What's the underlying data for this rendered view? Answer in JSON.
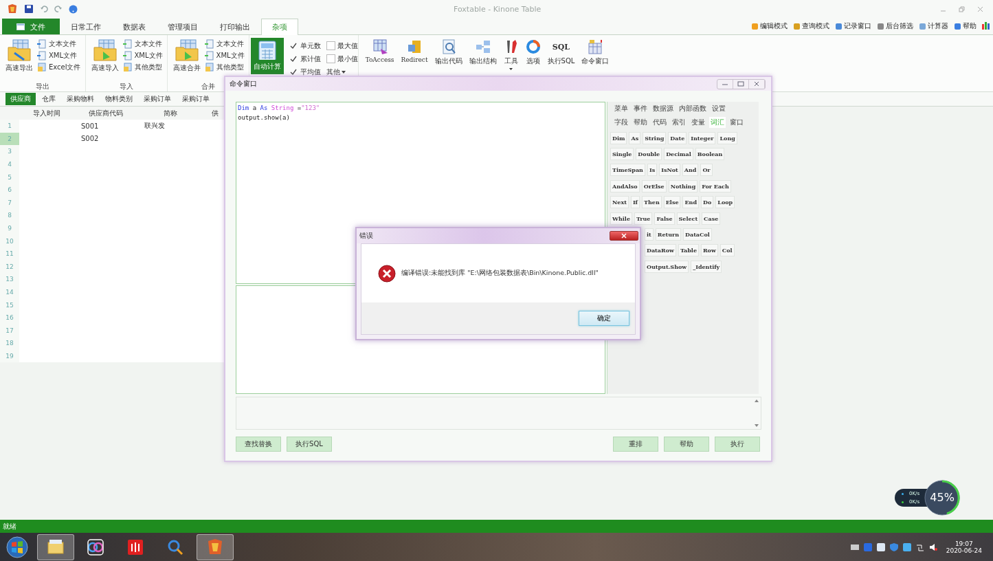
{
  "window": {
    "title": "Foxtable - Kinone Table"
  },
  "menu_tabs": [
    {
      "label": "文件",
      "kind": "file",
      "selected": false
    },
    {
      "label": "日常工作",
      "kind": "tab",
      "selected": false
    },
    {
      "label": "数据表",
      "kind": "tab",
      "selected": false
    },
    {
      "label": "管理项目",
      "kind": "tab",
      "selected": false
    },
    {
      "label": "打印输出",
      "kind": "tab",
      "selected": false
    },
    {
      "label": "杂项",
      "kind": "tab",
      "selected": true
    }
  ],
  "right_tools": [
    "编辑模式",
    "查询模式",
    "记录窗口",
    "后台筛选",
    "计算器",
    "帮助"
  ],
  "ribbon_groups": [
    {
      "label": "导出",
      "large": "高速导出",
      "small": [
        "文本文件",
        "XML文件",
        "Excel文件"
      ]
    },
    {
      "label": "导入",
      "large": "高速导入",
      "small": [
        "文本文件",
        "XML文件",
        "其他类型"
      ]
    },
    {
      "label": "合并",
      "large": "高速合并",
      "small": [
        "文本文件",
        "XML文件",
        "其他类型"
      ]
    }
  ],
  "auto_calc": {
    "label": "自动计算",
    "on": true
  },
  "calc_checks": [
    {
      "label": "单元数",
      "checked": true
    },
    {
      "label": "累计值",
      "checked": true
    },
    {
      "label": "平均值",
      "checked": true
    },
    {
      "label": "最大值",
      "checked": false
    },
    {
      "label": "最小值",
      "checked": false
    }
  ],
  "calc_more": "其他",
  "sql_icon_text": "SQL",
  "tool_buttons": [
    "ToAccess",
    "Redirect",
    "输出代码",
    "输出结构",
    "工具",
    "选项",
    "执行SQL",
    "命令窗口"
  ],
  "sheet_tabs": [
    {
      "label": "供应商",
      "selected": true
    },
    {
      "label": "仓库",
      "selected": false
    },
    {
      "label": "采购物料",
      "selected": false
    },
    {
      "label": "物料类别",
      "selected": false
    },
    {
      "label": "采购订单",
      "selected": false
    },
    {
      "label": "采购订单",
      "selected": false
    }
  ],
  "table": {
    "columns": [
      "导入时间",
      "供应商代码",
      "简称",
      "供"
    ],
    "rows": [
      {
        "number": "1",
        "selected": false,
        "cells": [
          "",
          "S001",
          "联兴发"
        ]
      },
      {
        "number": "2",
        "selected": true,
        "cells": [
          "",
          "S002",
          ""
        ]
      },
      {
        "number": "3",
        "selected": false,
        "cells": []
      },
      {
        "number": "4",
        "selected": false,
        "cells": []
      },
      {
        "number": "5",
        "selected": false,
        "cells": []
      },
      {
        "number": "6",
        "selected": false,
        "cells": []
      },
      {
        "number": "7",
        "selected": false,
        "cells": []
      },
      {
        "number": "8",
        "selected": false,
        "cells": []
      },
      {
        "number": "9",
        "selected": false,
        "cells": []
      },
      {
        "number": "10",
        "selected": false,
        "cells": []
      },
      {
        "number": "11",
        "selected": false,
        "cells": []
      },
      {
        "number": "12",
        "selected": false,
        "cells": []
      },
      {
        "number": "13",
        "selected": false,
        "cells": []
      },
      {
        "number": "14",
        "selected": false,
        "cells": []
      },
      {
        "number": "15",
        "selected": false,
        "cells": []
      },
      {
        "number": "16",
        "selected": false,
        "cells": []
      },
      {
        "number": "17",
        "selected": false,
        "cells": []
      },
      {
        "number": "18",
        "selected": false,
        "cells": []
      },
      {
        "number": "19",
        "selected": false,
        "cells": []
      }
    ]
  },
  "command_window": {
    "title": "命令窗口",
    "code_lines": [
      [
        {
          "text": "Dim",
          "kind": "keyword"
        },
        {
          "text": " a ",
          "kind": "plain"
        },
        {
          "text": "As ",
          "kind": "keyword"
        },
        {
          "text": "String",
          "kind": "type"
        },
        {
          "text": " =",
          "kind": "plain"
        },
        {
          "text": "\"123\"",
          "kind": "string"
        }
      ],
      [
        {
          "text": "output.show(a)",
          "kind": "plain"
        }
      ]
    ],
    "panel_tabs": [
      [
        {
          "label": "菜单",
          "selected": false
        },
        {
          "label": "事件",
          "selected": false
        },
        {
          "label": "数据源",
          "selected": false
        },
        {
          "label": "内部函数",
          "selected": false
        },
        {
          "label": "设置",
          "selected": false
        }
      ],
      [
        {
          "label": "字段",
          "selected": false
        },
        {
          "label": "帮助",
          "selected": false
        },
        {
          "label": "代码",
          "selected": false
        },
        {
          "label": "索引",
          "selected": false
        },
        {
          "label": "变量",
          "selected": false
        },
        {
          "label": "词汇",
          "selected": true
        },
        {
          "label": "窗口",
          "selected": false
        }
      ]
    ],
    "keyword_rows": [
      [
        "Dim",
        "As",
        "String",
        "Date",
        "Integer",
        "Long"
      ],
      [
        "Single",
        "Double",
        "Decimal",
        "Boolean"
      ],
      [
        "TimeSpan",
        "Is",
        "IsNot",
        "And",
        "Or"
      ],
      [
        "AndAlso",
        "OrElse",
        "Nothing",
        "For Each"
      ],
      [
        "Next",
        "If",
        "Then",
        "Else",
        "End",
        "Do",
        "Loop"
      ],
      [
        "While",
        "True",
        "False",
        "Select",
        "Case"
      ],
      [
        "it",
        "Return",
        "DataCol"
      ],
      [
        "DataRow",
        "Table",
        "Row",
        "Col"
      ],
      [
        "Output.Show",
        "_Identify"
      ]
    ],
    "left_buttons": [
      "查找替换",
      "执行SQL"
    ],
    "right_buttons": [
      "重排",
      "帮助",
      "执行"
    ]
  },
  "dialog": {
    "title": "错误",
    "message": "编译错误:未能找到库 \"E:\\网络包装数据表\\Bin\\Kinone.Public.dll\"",
    "button": "确定"
  },
  "status_bar": {
    "text": "就绪"
  },
  "net_widget": {
    "upload": "0K/s",
    "download": "0K/s",
    "load": "45%"
  },
  "taskbar": {
    "apps": [
      {
        "open": true
      },
      {
        "open": false
      },
      {
        "open": false
      },
      {
        "open": false
      },
      {
        "open": true
      }
    ],
    "time": "19:07",
    "date": "2020-06-24"
  }
}
